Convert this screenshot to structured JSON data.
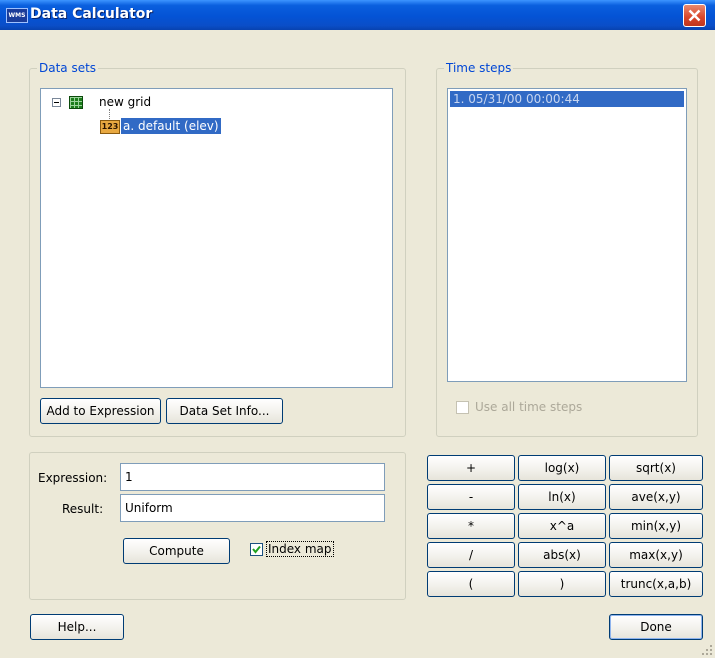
{
  "window": {
    "title": "Data Calculator",
    "icon_text": "WMS"
  },
  "datasets": {
    "group_label": "Data sets",
    "tree": {
      "root_label": "new grid",
      "child_icon_text": "123",
      "child_label": "a. default (elev)"
    },
    "add_to_expression": "Add to Expression",
    "data_set_info": "Data Set Info..."
  },
  "timesteps": {
    "group_label": "Time steps",
    "items": [
      "1.  05/31/00 00:00:44"
    ],
    "use_all_label": "Use all time steps",
    "use_all_checked": false
  },
  "expression": {
    "expression_label": "Expression:",
    "expression_value": "1",
    "result_label": "Result:",
    "result_value": "Uniform",
    "compute": "Compute",
    "index_map_label": "Index map",
    "index_map_checked": true
  },
  "calculator": {
    "buttons": [
      [
        "+",
        "log(x)",
        "sqrt(x)"
      ],
      [
        "-",
        "ln(x)",
        "ave(x,y)"
      ],
      [
        "*",
        "x^a",
        "min(x,y)"
      ],
      [
        "/",
        "abs(x)",
        "max(x,y)"
      ],
      [
        "(",
        ")",
        "trunc(x,a,b)"
      ]
    ]
  },
  "footer": {
    "help": "Help...",
    "done": "Done"
  }
}
